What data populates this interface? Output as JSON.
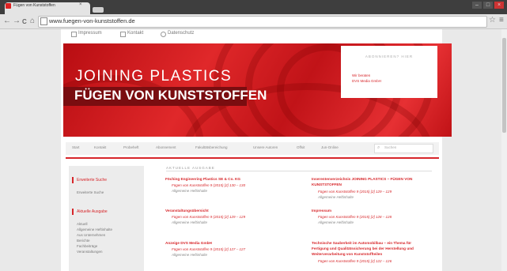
{
  "browser": {
    "tab_title": "Fügen von Kunststoffen",
    "tab_close": "×",
    "url": "www.fuegen-von-kunststoffen.de",
    "back": "←",
    "forward": "→",
    "reload": "C",
    "home": "⌂",
    "star": "☆",
    "menu": "≡",
    "win_min": "–",
    "win_max": "□",
    "win_close": "×"
  },
  "toplinks": [
    "Impressum",
    "Kontakt",
    "Datenschutz"
  ],
  "banner": {
    "title_line1": "JOINING PLASTICS",
    "title_line2": "FÜGEN VON KUNSTSTOFFEN",
    "info_title": "ABONNIEREN? HIER",
    "info_line1": "Wir beraten",
    "info_line2": "DVS Media GmbH"
  },
  "nav": [
    "Start",
    "Kontakt",
    "Probeheft",
    "Abonnement",
    "Fakultätsbereichung",
    "Unsere Autoren",
    "Offsit",
    "Jun-Online"
  ],
  "search_placeholder": "Suchen",
  "sidebar": {
    "head1": "Erweiterte Suche",
    "item1": "Erweiterte Suche",
    "head2": "Aktuelle Ausgabe",
    "items": [
      "Aktuell",
      "Allgemeine Heftinhalte",
      "Aus Unternehmen",
      "Berichte",
      "Fachbeiträge",
      "Veranstaltungen"
    ]
  },
  "section_label": "AKTUELLE AUSGABE",
  "articles_left": [
    {
      "title": "Föching Engineering Plastics SE & Co. KG",
      "src": "Fügen von Kunststoffen 9 (2015) [2] 130 – 130",
      "cat": "Allgemeine Heftinhalte"
    },
    {
      "title": "Veranstaltungsübersicht",
      "src": "Fügen von Kunststoffen 9 (2015) [2] 129 – 129",
      "cat": "Allgemeine Heftinhalte"
    },
    {
      "title": "Anzeige DVS Media GmbH",
      "src": "Fügen von Kunststoffen 9 (2015) [2] 127 – 127",
      "cat": "Allgemeine Heftinhalte"
    }
  ],
  "articles_right": [
    {
      "title1": "Inserentenverzeichnis JOINING PLASTICS – FÜGEN VON",
      "title2": "KUNSTSTOFFEN",
      "src": "Fügen von Kunststoffen 9 (2015) [2] 129 – 129",
      "cat": "Allgemeine Heftinhalte"
    },
    {
      "title1": "Impressum",
      "src": "Fügen von Kunststoffen 9 (2015) [2] 128 – 128",
      "cat": "Allgemeine Heftinhalte"
    },
    {
      "title1": "Technische Sauberkeit im Automobilbau – ein Thema für",
      "title2": "Fertigung und Qualitätssicherung bei der Herstellung und",
      "title3": "Weiterverarbeitung von Kunststoffteilen",
      "src": "Fügen von Kunststoffen 9 (2015) [2] 122 – 126"
    }
  ]
}
